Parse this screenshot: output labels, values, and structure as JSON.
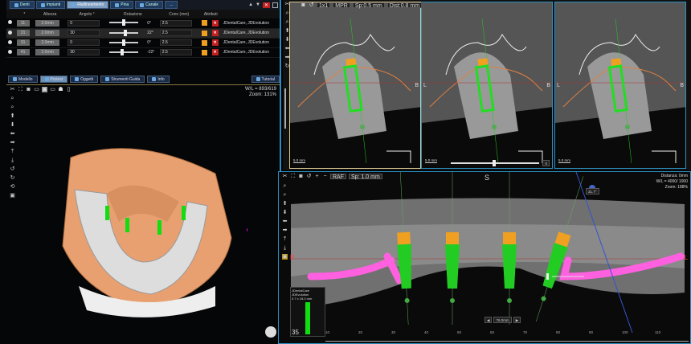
{
  "left_panel": {
    "top_tabs": [
      {
        "label": "Denti"
      },
      {
        "label": "Impianti"
      },
      {
        "label": "Riallineamento"
      },
      {
        "label": "Pina"
      },
      {
        "label": "Canale"
      },
      {
        "label": "..."
      }
    ],
    "table": {
      "headers": [
        "*",
        "Altezza",
        "Angolo °",
        "Rotazione",
        "Cono (mm)",
        "Attributi"
      ],
      "rows": [
        {
          "tooth": "11",
          "altezza": "2.0mm",
          "angolo": "0",
          "rotazione": "0°",
          "rot_value": 0.5,
          "cono": "2.5",
          "attributi": "JDentalCare, JDEvolution"
        },
        {
          "tooth": "21",
          "altezza": "2.0mm",
          "angolo": "30",
          "rotazione": "22°",
          "rot_value": 0.56,
          "cono": "2.5",
          "attributi": "JDentalCare, JDEvolution"
        },
        {
          "tooth": "31",
          "altezza": "2.0mm",
          "angolo": "0",
          "rotazione": "0°",
          "rot_value": 0.5,
          "cono": "2.5",
          "attributi": "JDentalCare, JDEvolution"
        },
        {
          "tooth": "41",
          "altezza": "2.0mm",
          "angolo": "30",
          "rotazione": "-22°",
          "rot_value": 0.44,
          "cono": "2.5",
          "attributi": "JDentalCare, JDEvolution"
        }
      ]
    },
    "bottom_tabs": [
      {
        "label": "Modello"
      },
      {
        "label": "Protesi"
      },
      {
        "label": "Oggetti"
      },
      {
        "label": "Strumenti Guida"
      },
      {
        "label": "Info"
      }
    ],
    "tutorial_label": "Tutorial",
    "view3d": {
      "wl": "W/L = 893/619",
      "zoom": "Zoom: 131%"
    }
  },
  "cross_sections": {
    "toolbar": [
      "1x1",
      "MPR",
      "Sp:0.5 mm",
      "Dist:0.8 mm"
    ],
    "views": [
      {
        "left": "",
        "right": "B",
        "scale": "5.0 mm"
      },
      {
        "left": "L",
        "right": "B",
        "scale": "5.0 mm",
        "slider_value": "0"
      },
      {
        "left": "L",
        "right": "B",
        "scale": "5.0 mm"
      }
    ]
  },
  "panoramic": {
    "toolbar": [
      "RAF",
      "Sp: 1.0 mm"
    ],
    "top_label": "S",
    "left_label": "R",
    "right_label": "L",
    "info": [
      "Distanza: 0mm",
      "W/L = 4000/ 1000",
      "Zoom: 188%"
    ],
    "angle": "31.7°",
    "implant_card": [
      "JDentalCare",
      "JDEvolution",
      "3.7 x 15.0 mm"
    ],
    "tooth_number": "35",
    "nav_distance": "76.0mm",
    "ruler_ticks": [
      "10",
      "20",
      "30",
      "40",
      "50",
      "60",
      "70",
      "80",
      "90",
      "100",
      "110"
    ]
  },
  "colors": {
    "accent": "#2a8fc0",
    "implant": "#22cc22",
    "abutment": "#f0a020",
    "nerve": "#ff60e0"
  }
}
